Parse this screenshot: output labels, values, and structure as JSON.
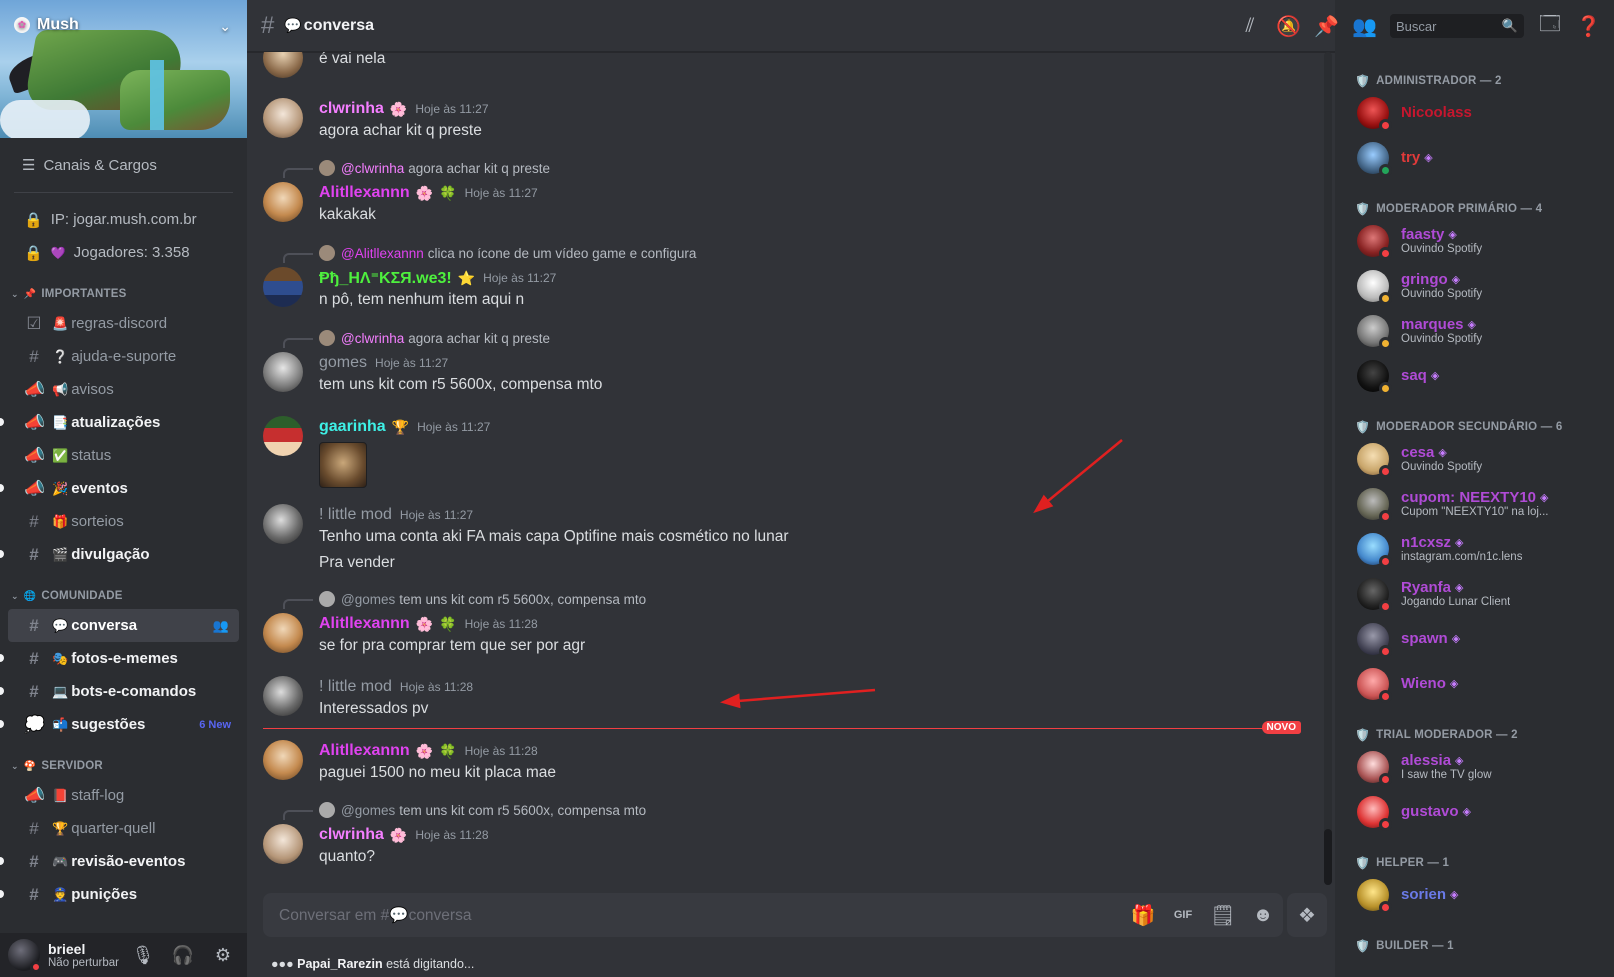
{
  "server": {
    "name": "Mush"
  },
  "sidebar": {
    "browse_label": "Canais & Cargos",
    "info": [
      {
        "label": "IP: jogar.mush.com.br",
        "icon": "lock-icon"
      },
      {
        "label": "Jogadores: 3.358",
        "icon": "lock-icon"
      }
    ],
    "categories": [
      {
        "title": "IMPORTANTES",
        "channels": [
          {
            "label": "regras-discord",
            "emoji": "🚨",
            "icon": "check",
            "unread": false
          },
          {
            "label": "ajuda-e-suporte",
            "emoji": "❔",
            "icon": "hash",
            "unread": false
          },
          {
            "label": "avisos",
            "emoji": "📢",
            "icon": "announce",
            "unread": false
          },
          {
            "label": "atualizações",
            "emoji": "📑",
            "icon": "announce",
            "unread": true
          },
          {
            "label": "status",
            "emoji": "✅",
            "icon": "announce",
            "unread": false
          },
          {
            "label": "eventos",
            "emoji": "🎉",
            "icon": "announce",
            "unread": true
          },
          {
            "label": "sorteios",
            "emoji": "🎁",
            "icon": "hash",
            "unread": false
          },
          {
            "label": "divulgação",
            "emoji": "🎬",
            "icon": "hash",
            "unread": true
          }
        ]
      },
      {
        "title": "COMUNIDADE",
        "channels": [
          {
            "label": "conversa",
            "emoji": "💬",
            "icon": "hash",
            "active": true
          },
          {
            "label": "fotos-e-memes",
            "emoji": "🎭",
            "icon": "hash",
            "unread": true
          },
          {
            "label": "bots-e-comandos",
            "emoji": "💻",
            "icon": "hash",
            "unread": true
          },
          {
            "label": "sugestões",
            "emoji": "📬",
            "icon": "forum",
            "unread": true,
            "badge": "6 New"
          }
        ]
      },
      {
        "title": "SERVIDOR",
        "channels": [
          {
            "label": "staff-log",
            "emoji": "📕",
            "icon": "announce",
            "unread": false
          },
          {
            "label": "quarter-quell",
            "emoji": "🏆",
            "icon": "hash",
            "unread": false
          },
          {
            "label": "revisão-eventos",
            "emoji": "🎮",
            "icon": "hash",
            "unread": true
          },
          {
            "label": "punições",
            "emoji": "👮",
            "icon": "hash",
            "unread": true
          }
        ]
      }
    ]
  },
  "user": {
    "name": "brieel",
    "status": "Não perturbar"
  },
  "channel": {
    "name": "conversa",
    "emoji": "💬"
  },
  "search": {
    "placeholder": "Buscar"
  },
  "messages": [
    {
      "id": "m0",
      "author": "",
      "text": "é vai nela",
      "time": ""
    },
    {
      "id": "m1",
      "author": "clwrinha",
      "color": "#f47fff",
      "badge": "🌸",
      "time": "Hoje às 11:27",
      "text": "agora achar kit q preste"
    },
    {
      "id": "m2",
      "reply_to": "@clwrinha",
      "reply_text": "agora achar kit q preste",
      "author": "Alitllexannn",
      "color": "#e043f0",
      "badge": "🌸",
      "badge2": "🍀",
      "time": "Hoje às 11:27",
      "text": "kakakak"
    },
    {
      "id": "m3",
      "reply_to": "@Alitllexannn",
      "reply_text": "clica no ícone de um vídeo game e configura",
      "author": "Ᵽђ_HΛ⁼ΚΣЯ.we3!",
      "color": "#4ef03e",
      "badge": "⭐",
      "time": "Hoje às 11:27",
      "text": "n pô, tem nenhum item aqui n"
    },
    {
      "id": "m4",
      "reply_to": "@clwrinha",
      "reply_text": "agora achar kit q preste",
      "author": "gomes",
      "color": "#949ba4",
      "time": "Hoje às 11:27",
      "text": "tem uns kit com r5 5600x, compensa mto"
    },
    {
      "id": "m5",
      "author": "gaarinha",
      "color": "#3ef0e6",
      "badge": "🏆",
      "time": "Hoje às 11:27",
      "text": ""
    },
    {
      "id": "m6",
      "author": "! little mod",
      "color": "#949ba4",
      "time": "Hoje às 11:27",
      "text": "Tenho uma conta aki FA mais capa Optifine mais cosmético no lunar",
      "text2": "Pra vender"
    },
    {
      "id": "m7",
      "reply_to": "@gomes",
      "reply_text": "tem uns kit com r5 5600x, compensa mto",
      "author": "Alitllexannn",
      "color": "#e043f0",
      "badge": "🌸",
      "badge2": "🍀",
      "time": "Hoje às 11:28",
      "text": "se for pra comprar tem que ser por agr"
    },
    {
      "id": "m8",
      "author": "! little mod",
      "color": "#949ba4",
      "time": "Hoje às 11:28",
      "text": "Interessados pv"
    },
    {
      "id": "m9",
      "author": "Alitllexannn",
      "color": "#e043f0",
      "badge": "🌸",
      "badge2": "🍀",
      "time": "Hoje às 11:28",
      "text": "paguei 1500 no meu kit placa mae"
    },
    {
      "id": "m10",
      "reply_to": "@gomes",
      "reply_text": "tem uns kit com r5 5600x, compensa mto",
      "author": "clwrinha",
      "color": "#f47fff",
      "badge": "🌸",
      "time": "Hoje às 11:28",
      "text": "quanto?"
    }
  ],
  "new_divider": "NOVO",
  "composer": {
    "placeholder": "Conversar em #💬conversa"
  },
  "typing": {
    "user": "Papai_Rarezin",
    "text": "está digitando..."
  },
  "members": {
    "groups": [
      {
        "title": "ADMINISTRADOR — 2",
        "icon": "🛡️",
        "items": [
          {
            "name": "Nicoolass",
            "color": "#c6162e",
            "status": "dnd",
            "activity": ""
          },
          {
            "name": "try",
            "color": "#e03a3a",
            "status": "online",
            "activity": ""
          }
        ]
      },
      {
        "title": "MODERADOR PRIMÁRIO — 4",
        "icon": "🛡️",
        "items": [
          {
            "name": "faasty",
            "color": "#b04bd6",
            "status": "dnd",
            "activity": "Ouvindo Spotify"
          },
          {
            "name": "gringo",
            "color": "#b04bd6",
            "status": "idle",
            "activity": "Ouvindo Spotify"
          },
          {
            "name": "marques",
            "color": "#b04bd6",
            "status": "idle",
            "activity": "Ouvindo Spotify"
          },
          {
            "name": "saq",
            "color": "#b04bd6",
            "status": "idle",
            "activity": ""
          }
        ]
      },
      {
        "title": "MODERADOR SECUNDÁRIO — 6",
        "icon": "🛡️",
        "items": [
          {
            "name": "cesa",
            "color": "#b04bd6",
            "status": "dnd",
            "activity": "Ouvindo Spotify"
          },
          {
            "name": "cupom: NEEXTY10",
            "color": "#b04bd6",
            "status": "dnd",
            "activity": "Cupom \"NEEXTY10\" na loj..."
          },
          {
            "name": "n1cxsz",
            "color": "#b04bd6",
            "status": "dnd",
            "activity": "instagram.com/n1c.lens"
          },
          {
            "name": "Ryanfa",
            "color": "#b04bd6",
            "status": "dnd",
            "activity": "Jogando Lunar Client"
          },
          {
            "name": "spawn",
            "color": "#b04bd6",
            "status": "dnd",
            "activity": ""
          },
          {
            "name": "Wieno",
            "color": "#b04bd6",
            "status": "dnd",
            "activity": ""
          }
        ]
      },
      {
        "title": "TRIAL MODERADOR — 2",
        "icon": "🛡️",
        "items": [
          {
            "name": "alessia",
            "color": "#b04bd6",
            "status": "dnd",
            "activity": "I saw the TV glow"
          },
          {
            "name": "gustavo",
            "color": "#b04bd6",
            "status": "dnd",
            "activity": ""
          }
        ]
      },
      {
        "title": "HELPER — 1",
        "icon": "🛡️",
        "items": [
          {
            "name": "sorien",
            "color": "#6a7ae6",
            "status": "dnd",
            "activity": ""
          }
        ]
      },
      {
        "title": "BUILDER — 1",
        "icon": "🛡️",
        "items": []
      }
    ]
  },
  "colors": {
    "accent": "#5865f2",
    "new_line": "#f23f43",
    "dnd": "#f23f43",
    "online": "#23a55a",
    "idle": "#f0b232"
  }
}
